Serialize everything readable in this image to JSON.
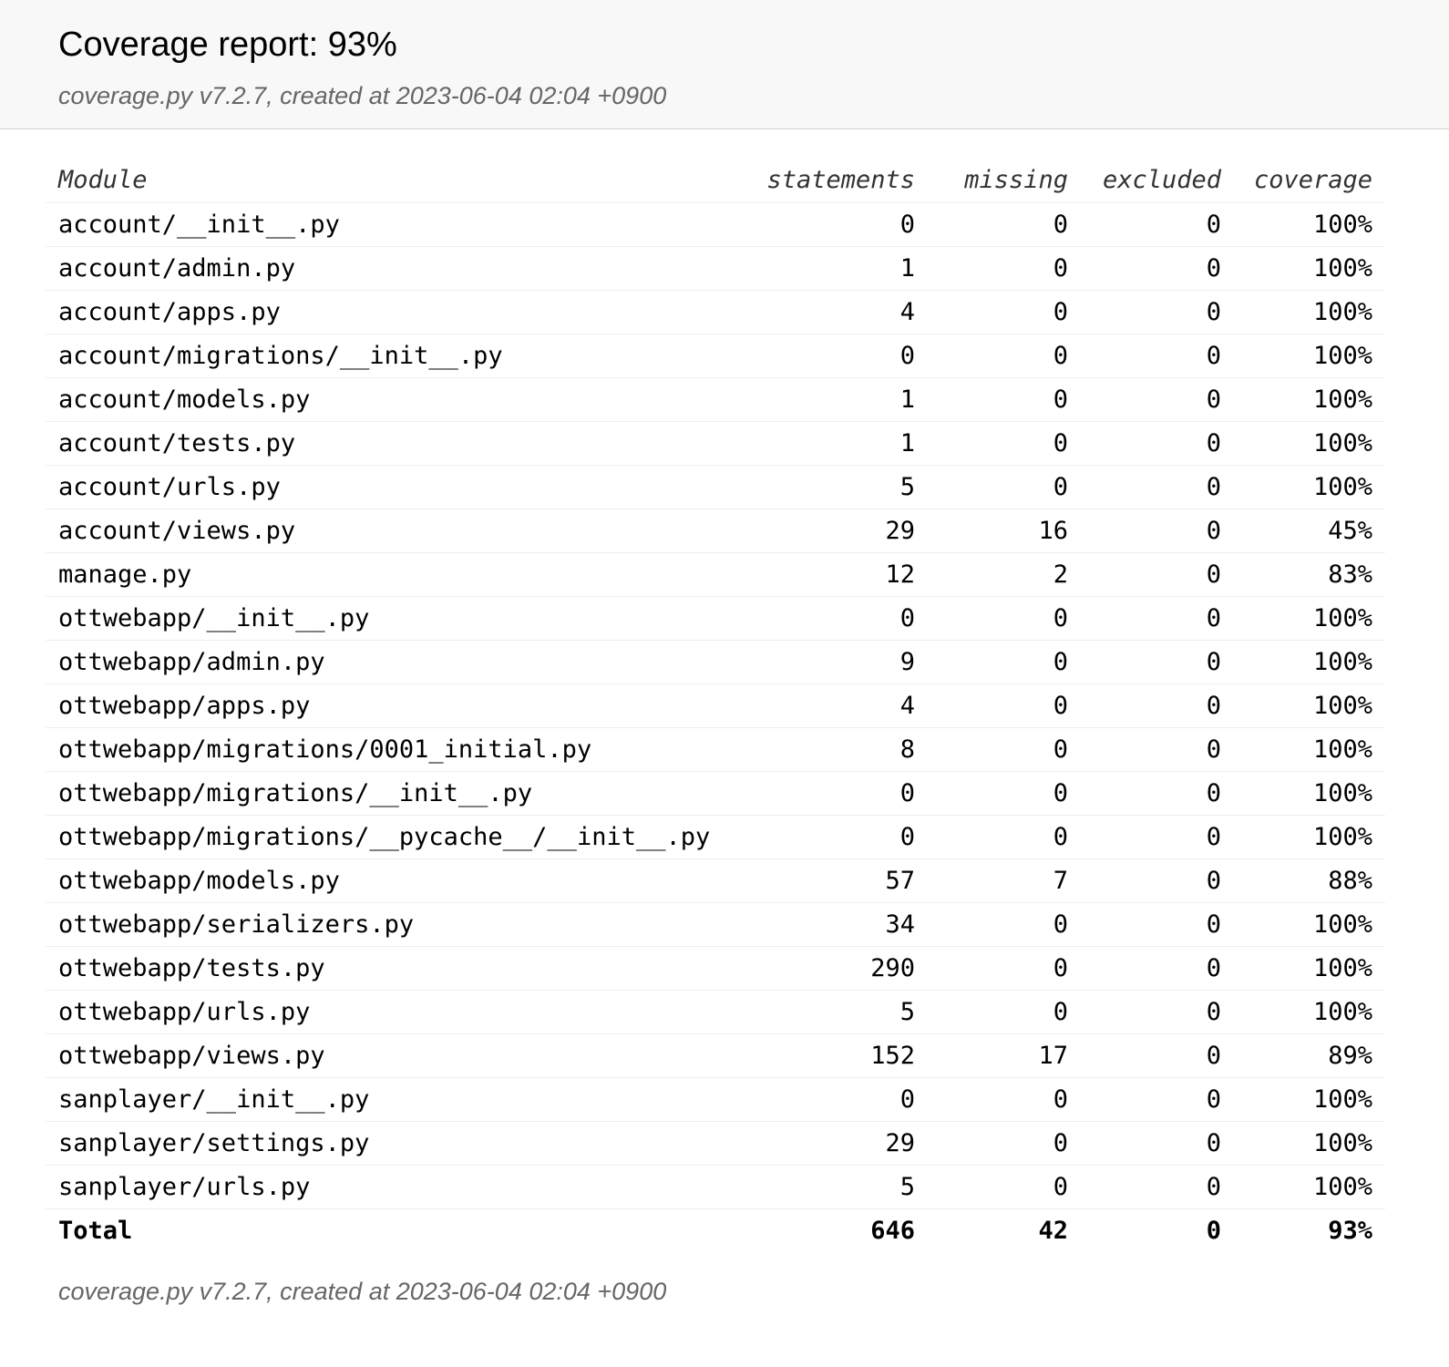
{
  "header": {
    "title": "Coverage report: 93%",
    "meta": "coverage.py v7.2.7, created at 2023-06-04 02:04 +0900"
  },
  "table": {
    "columns": [
      "Module",
      "statements",
      "missing",
      "excluded",
      "coverage"
    ],
    "rows": [
      {
        "module": "account/__init__.py",
        "statements": "0",
        "missing": "0",
        "excluded": "0",
        "coverage": "100%"
      },
      {
        "module": "account/admin.py",
        "statements": "1",
        "missing": "0",
        "excluded": "0",
        "coverage": "100%"
      },
      {
        "module": "account/apps.py",
        "statements": "4",
        "missing": "0",
        "excluded": "0",
        "coverage": "100%"
      },
      {
        "module": "account/migrations/__init__.py",
        "statements": "0",
        "missing": "0",
        "excluded": "0",
        "coverage": "100%"
      },
      {
        "module": "account/models.py",
        "statements": "1",
        "missing": "0",
        "excluded": "0",
        "coverage": "100%"
      },
      {
        "module": "account/tests.py",
        "statements": "1",
        "missing": "0",
        "excluded": "0",
        "coverage": "100%"
      },
      {
        "module": "account/urls.py",
        "statements": "5",
        "missing": "0",
        "excluded": "0",
        "coverage": "100%"
      },
      {
        "module": "account/views.py",
        "statements": "29",
        "missing": "16",
        "excluded": "0",
        "coverage": "45%"
      },
      {
        "module": "manage.py",
        "statements": "12",
        "missing": "2",
        "excluded": "0",
        "coverage": "83%"
      },
      {
        "module": "ottwebapp/__init__.py",
        "statements": "0",
        "missing": "0",
        "excluded": "0",
        "coverage": "100%"
      },
      {
        "module": "ottwebapp/admin.py",
        "statements": "9",
        "missing": "0",
        "excluded": "0",
        "coverage": "100%"
      },
      {
        "module": "ottwebapp/apps.py",
        "statements": "4",
        "missing": "0",
        "excluded": "0",
        "coverage": "100%"
      },
      {
        "module": "ottwebapp/migrations/0001_initial.py",
        "statements": "8",
        "missing": "0",
        "excluded": "0",
        "coverage": "100%"
      },
      {
        "module": "ottwebapp/migrations/__init__.py",
        "statements": "0",
        "missing": "0",
        "excluded": "0",
        "coverage": "100%"
      },
      {
        "module": "ottwebapp/migrations/__pycache__/__init__.py",
        "statements": "0",
        "missing": "0",
        "excluded": "0",
        "coverage": "100%"
      },
      {
        "module": "ottwebapp/models.py",
        "statements": "57",
        "missing": "7",
        "excluded": "0",
        "coverage": "88%"
      },
      {
        "module": "ottwebapp/serializers.py",
        "statements": "34",
        "missing": "0",
        "excluded": "0",
        "coverage": "100%"
      },
      {
        "module": "ottwebapp/tests.py",
        "statements": "290",
        "missing": "0",
        "excluded": "0",
        "coverage": "100%"
      },
      {
        "module": "ottwebapp/urls.py",
        "statements": "5",
        "missing": "0",
        "excluded": "0",
        "coverage": "100%"
      },
      {
        "module": "ottwebapp/views.py",
        "statements": "152",
        "missing": "17",
        "excluded": "0",
        "coverage": "89%"
      },
      {
        "module": "sanplayer/__init__.py",
        "statements": "0",
        "missing": "0",
        "excluded": "0",
        "coverage": "100%"
      },
      {
        "module": "sanplayer/settings.py",
        "statements": "29",
        "missing": "0",
        "excluded": "0",
        "coverage": "100%"
      },
      {
        "module": "sanplayer/urls.py",
        "statements": "5",
        "missing": "0",
        "excluded": "0",
        "coverage": "100%"
      }
    ],
    "total": {
      "module": "Total",
      "statements": "646",
      "missing": "42",
      "excluded": "0",
      "coverage": "93%"
    }
  },
  "footer": {
    "meta": "coverage.py v7.2.7, created at 2023-06-04 02:04 +0900"
  }
}
